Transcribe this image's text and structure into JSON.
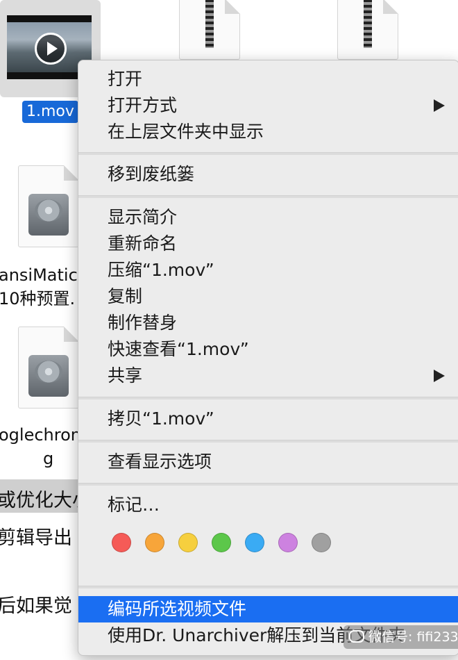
{
  "desktop": {
    "selected_file_label": "1.mov",
    "file2_line1": "ansiMatic转",
    "file2_line2": "10种预置.",
    "file3_line1": "oglechrom",
    "file3_line2": "g",
    "bg_text_1": "或优化大小",
    "bg_text_2": "剪辑导出",
    "bg_text_3": "后如果觉"
  },
  "menu": {
    "open": "打开",
    "open_with": "打开方式",
    "show_in_enclosing": "在上层文件夹中显示",
    "move_to_trash": "移到废纸篓",
    "get_info": "显示简介",
    "rename": "重新命名",
    "compress": "压缩“1.mov”",
    "duplicate": "复制",
    "make_alias": "制作替身",
    "quick_look": "快速查看“1.mov”",
    "share": "共享",
    "copy": "拷贝“1.mov”",
    "view_options": "查看显示选项",
    "tags": "标记…",
    "encode_video": "编码所选视频文件",
    "unarchiver": "使用Dr. Unarchiver解压到当前文件夹"
  },
  "tag_colors": [
    {
      "name": "red",
      "hex": "#f55b57"
    },
    {
      "name": "orange",
      "hex": "#f7a53a"
    },
    {
      "name": "yellow",
      "hex": "#f6cf3e"
    },
    {
      "name": "green",
      "hex": "#5cc74a"
    },
    {
      "name": "blue",
      "hex": "#3aabf4"
    },
    {
      "name": "purple",
      "hex": "#cd82e0"
    },
    {
      "name": "gray",
      "hex": "#a0a0a0"
    }
  ],
  "watermark": {
    "text": "微信号: fifi233"
  },
  "colors": {
    "highlight": "#1a6ef2",
    "selection_label": "#1869d8"
  }
}
